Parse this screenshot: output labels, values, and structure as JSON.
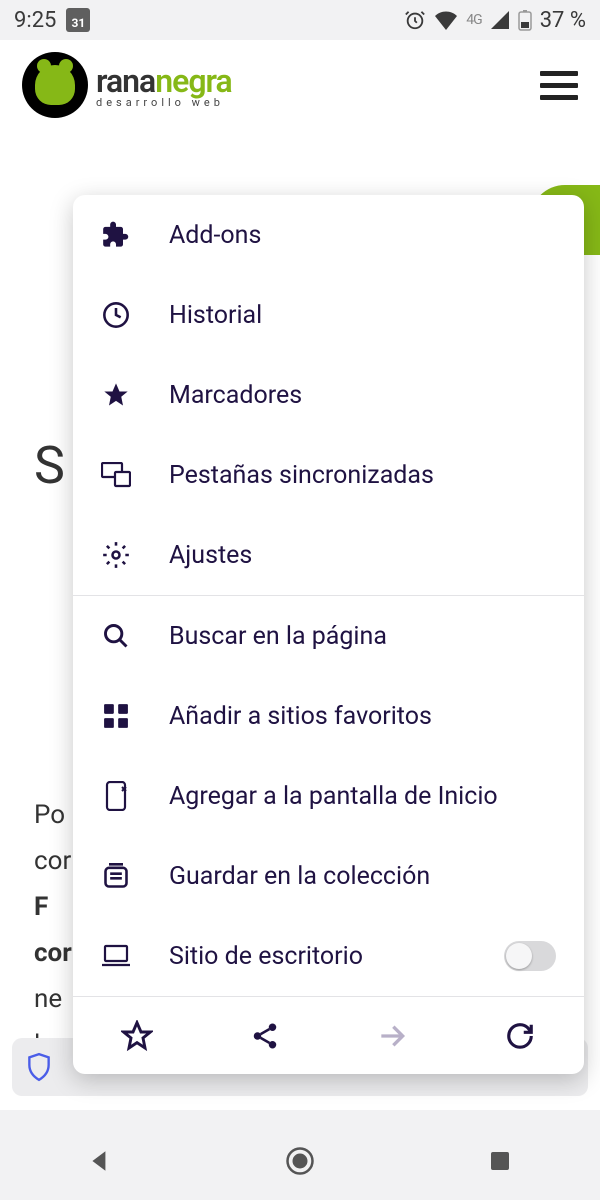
{
  "status": {
    "time": "9:25",
    "cal": "31",
    "net": "4G",
    "battery": "37 %"
  },
  "brand": {
    "part1": "rana",
    "part2": "negra",
    "sub": "desarrollo web"
  },
  "bg": {
    "s": "S",
    "p1": "Po",
    "p2": "cor",
    "p3": "F",
    "p4": "cor",
    "p5": "ne",
    "p6": "los e"
  },
  "menu": {
    "addons": "Add-ons",
    "history": "Historial",
    "bookmarks": "Marcadores",
    "synced": "Pestañas sincronizadas",
    "settings": "Ajustes",
    "find": "Buscar en la página",
    "topsites": "Añadir a sitios favoritos",
    "homescreen": "Agregar a la pantalla de Inicio",
    "collection": "Guardar en la colección",
    "desktop": "Sitio de escritorio"
  }
}
